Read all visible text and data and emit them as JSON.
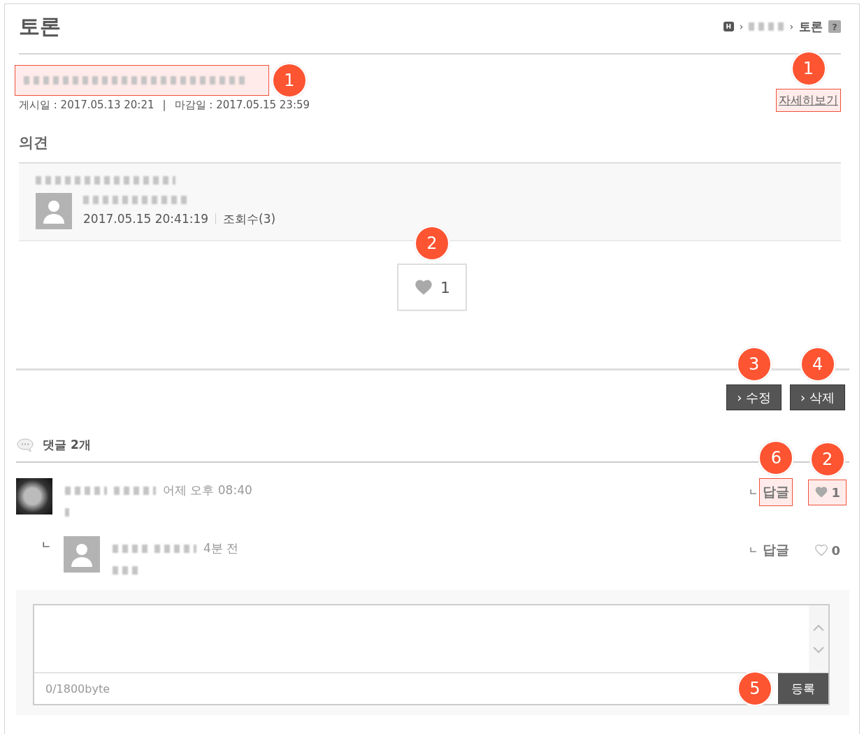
{
  "header": {
    "title": "토론",
    "breadcrumb": {
      "home": "H",
      "separator": "›",
      "current": "토론",
      "help": "?"
    }
  },
  "topic": {
    "highlighted": true,
    "callout": "1",
    "posted": "게시일 : 2017.05.13 20:21",
    "separator": "|",
    "deadline": "마감일 : 2017.05.15 23:59",
    "detail_link": {
      "label": "자세히보기",
      "highlighted": true,
      "callout": "1"
    }
  },
  "opinion": {
    "heading": "의견",
    "date": "2017.05.15 20:41:19",
    "views": "조회수(3)",
    "like": {
      "count": "1",
      "liked": true,
      "callout": "2"
    }
  },
  "actions": [
    {
      "chevron": "›",
      "label": "수정",
      "callout": "3"
    },
    {
      "chevron": "›",
      "label": "삭제",
      "callout": "4"
    }
  ],
  "comments": {
    "heading": "댓글 2개",
    "items": [
      {
        "time": "어제 오후 08:40",
        "reply_prefix": "ㄴ",
        "reply_label": "답글",
        "reply_highlighted": true,
        "reply_callout": "6",
        "liked": true,
        "likes": "1",
        "like_highlighted": true,
        "like_callout": "2",
        "children": [
          {
            "branch": "ㄴ",
            "time": "4분 전",
            "reply_prefix": "ㄴ",
            "reply_label": "답글",
            "reply_highlighted": false,
            "liked": false,
            "likes": "0",
            "like_highlighted": false
          }
        ]
      }
    ]
  },
  "editor": {
    "counter": "0/1800byte",
    "submit": "등록",
    "callout": "5"
  }
}
